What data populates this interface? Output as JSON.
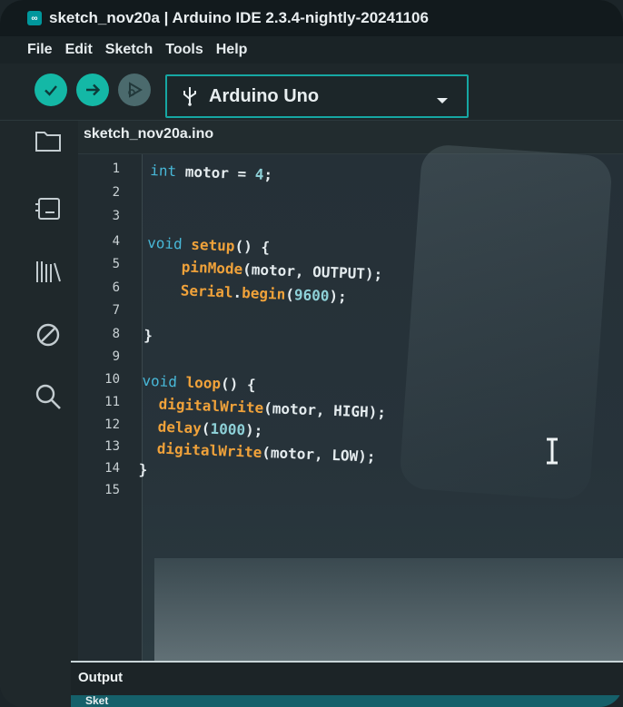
{
  "window": {
    "title": "sketch_nov20a | Arduino IDE 2.3.4-nightly-20241106"
  },
  "menu": [
    "File",
    "Edit",
    "Sketch",
    "Tools",
    "Help"
  ],
  "toolbar": {
    "board": "Arduino Uno"
  },
  "icons": {
    "verify": "checkmark-icon",
    "upload": "arrow-right-icon",
    "debug": "debug-icon",
    "board": "usb-icon",
    "dropdown": "chevron-down-icon",
    "sidebar": [
      "folder-icon",
      "board-manager-icon",
      "library-icon",
      "debug-disabled-icon",
      "search-icon"
    ]
  },
  "editor": {
    "tab": "sketch_nov20a.ino",
    "line_numbers": [
      "1",
      "2",
      "3",
      "4",
      "5",
      "6",
      "7",
      "8",
      "9",
      "10",
      "11",
      "12",
      "13",
      "14",
      "15"
    ],
    "code": [
      "int motor = 4;",
      "",
      "",
      "void setup() {",
      "    pinMode(motor, OUTPUT);",
      "    Serial.begin(9600);",
      "",
      "}",
      "",
      "void loop() {",
      "  digitalWrite(motor, HIGH);",
      "  delay(1000);",
      "  digitalWrite(motor, LOW);",
      "}",
      ""
    ]
  },
  "output": {
    "label": "Output",
    "strip_label": "Sket"
  },
  "colors": {
    "accent": "#14b8a6",
    "keyword": "#48b8d8",
    "function": "#f0a23a"
  }
}
